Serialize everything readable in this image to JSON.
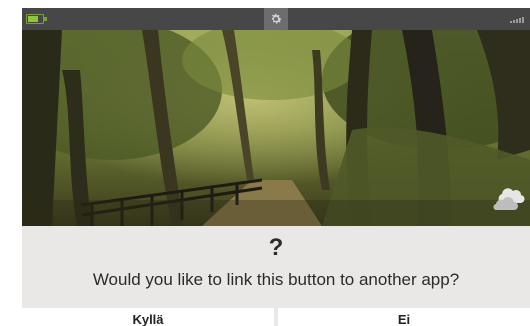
{
  "status_bar": {
    "battery_icon": "battery-icon",
    "settings_icon": "gear-icon",
    "signal_icon": "signal-icon"
  },
  "background": {
    "weather_icon": "cloud-icon"
  },
  "dialog": {
    "symbol": "?",
    "prompt": "Would you like to link this button to another app?",
    "yes_label": "Kyllä",
    "no_label": "Ei"
  },
  "colors": {
    "status_bar": "#474747",
    "dialog_bg": "#e9e8e6",
    "button_bg": "#ffffff",
    "battery": "#8dc63f"
  }
}
